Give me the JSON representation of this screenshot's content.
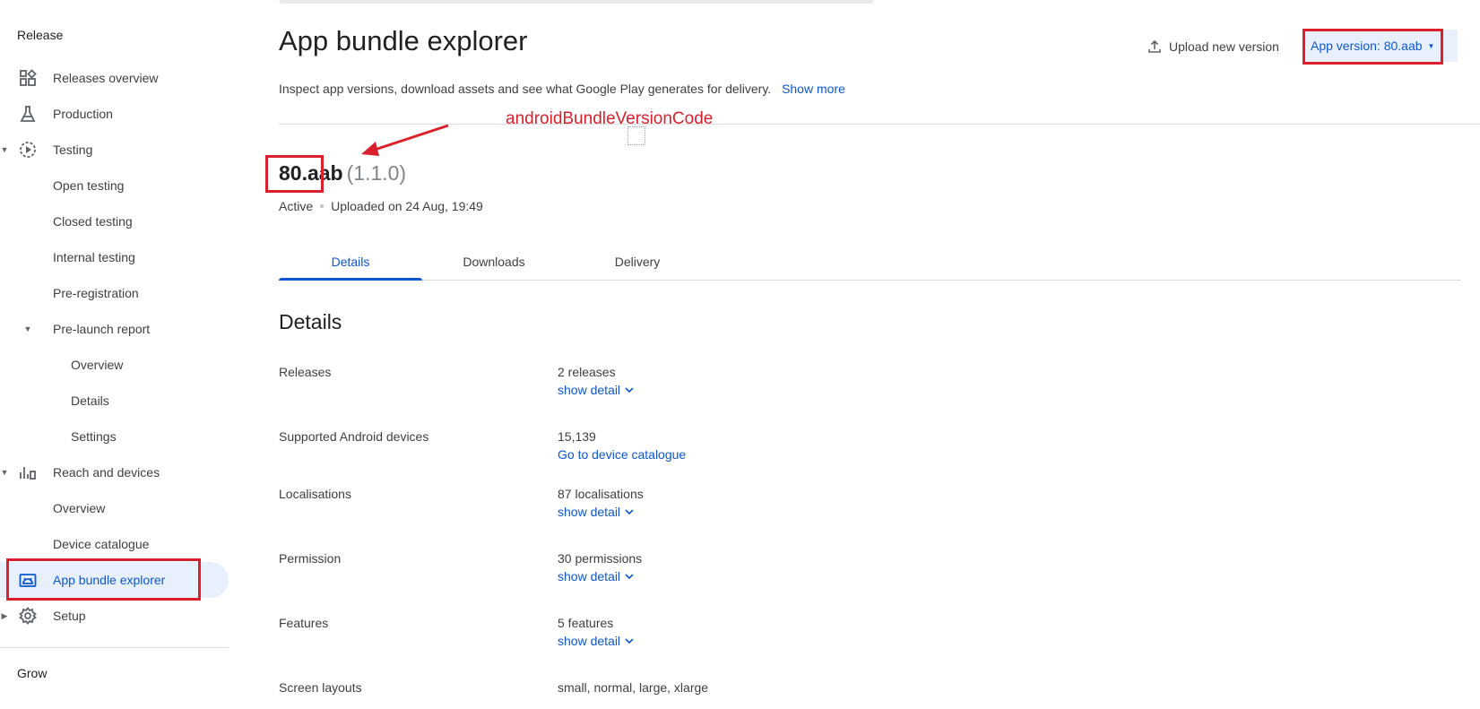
{
  "sidebar": {
    "section_release": "Release",
    "section_grow": "Grow",
    "items": [
      {
        "label": "Releases overview",
        "icon": "dashboard-icon"
      },
      {
        "label": "Production",
        "icon": "flask-icon"
      },
      {
        "label": "Testing",
        "icon": "play-circle-icon"
      },
      {
        "label": "Open testing"
      },
      {
        "label": "Closed testing"
      },
      {
        "label": "Internal testing"
      },
      {
        "label": "Pre-registration"
      },
      {
        "label": "Pre-launch report"
      },
      {
        "label": "Overview"
      },
      {
        "label": "Details"
      },
      {
        "label": "Settings"
      },
      {
        "label": "Reach and devices",
        "icon": "bar-chart-icon"
      },
      {
        "label": "Overview"
      },
      {
        "label": "Device catalogue"
      },
      {
        "label": "App bundle explorer",
        "icon": "android-bundle-icon"
      },
      {
        "label": "Setup",
        "icon": "gear-icon"
      }
    ]
  },
  "header": {
    "title": "App bundle explorer",
    "upload_label": "Upload new version",
    "version_selector": "App version: 80.aab",
    "subtitle": "Inspect app versions, download assets and see what Google Play generates for delivery.",
    "show_more": "Show more"
  },
  "annotation": {
    "text": "androidBundleVersionCode",
    "color": "#d9202c"
  },
  "version": {
    "name": "80.aab",
    "version_name": "(1.1.0)",
    "status": "Active",
    "uploaded": "Uploaded on 24 Aug, 19:49"
  },
  "tabs": [
    {
      "label": "Details",
      "active": true
    },
    {
      "label": "Downloads",
      "active": false
    },
    {
      "label": "Delivery",
      "active": false
    }
  ],
  "details": {
    "heading": "Details",
    "rows": [
      {
        "label": "Releases",
        "value": "2 releases",
        "link": "show detail"
      },
      {
        "label": "Supported Android devices",
        "value": "15,139",
        "link": "Go to device catalogue"
      },
      {
        "label": "Localisations",
        "value": "87 localisations",
        "link": "show detail"
      },
      {
        "label": "Permission",
        "value": "30 permissions",
        "link": "show detail"
      },
      {
        "label": "Features",
        "value": "5 features",
        "link": "show detail"
      },
      {
        "label": "Screen layouts",
        "value": "small, normal, large, xlarge"
      }
    ]
  },
  "colors": {
    "accent": "#0b57d0",
    "active_bg": "#e8f0fe",
    "annotation": "#d9202c"
  }
}
